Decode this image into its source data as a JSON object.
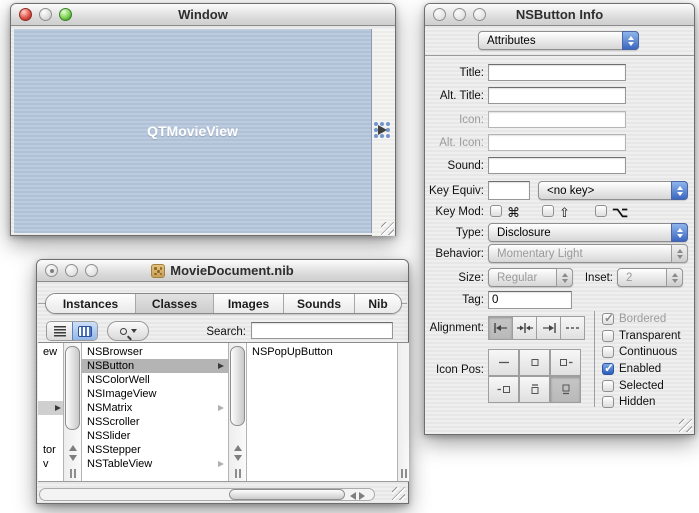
{
  "colors": {
    "accent_blue": "#3c67c0",
    "selection_gray": "#b4b4b4",
    "view_blue": "#b3c2da"
  },
  "design_window": {
    "title": "Window",
    "view_label": "QTMovieView"
  },
  "nib_window": {
    "title": "MovieDocument.nib",
    "tabs": [
      {
        "label": "Instances"
      },
      {
        "label": "Classes"
      },
      {
        "label": "Images"
      },
      {
        "label": "Sounds"
      },
      {
        "label": "Nib"
      }
    ],
    "selected_tab": "Classes",
    "toolbar": {
      "search_label": "Search:",
      "search_value": ""
    },
    "browser": {
      "col1_fragments": [
        "ew",
        "tor",
        "v"
      ],
      "col2": [
        "NSBrowser",
        "NSButton",
        "NSColorWell",
        "NSImageView",
        "NSMatrix",
        "NSScroller",
        "NSSlider",
        "NSStepper",
        "NSTableView"
      ],
      "col2_selected": "NSButton",
      "col3": [
        "NSPopUpButton"
      ]
    }
  },
  "inspector": {
    "title": "NSButton Info",
    "pane": "Attributes",
    "labels": {
      "title": "Title:",
      "alt_title": "Alt. Title:",
      "icon": "Icon:",
      "alt_icon": "Alt. Icon:",
      "sound": "Sound:",
      "key_equiv": "Key Equiv:",
      "key_mod": "Key Mod:",
      "type": "Type:",
      "behavior": "Behavior:",
      "size": "Size:",
      "inset": "Inset:",
      "tag": "Tag:",
      "alignment": "Alignment:",
      "icon_pos": "Icon Pos:"
    },
    "values": {
      "title": "",
      "alt_title": "",
      "icon": "",
      "alt_icon": "",
      "sound": "",
      "key_equiv": "",
      "key_popup": "<no key>",
      "type": "Disclosure",
      "behavior": "Momentary Light",
      "size": "Regular",
      "inset": "2",
      "tag": "0"
    },
    "key_mod_symbols": [
      "⌘",
      "⇧",
      "⌥"
    ],
    "checkboxes": [
      {
        "label": "Bordered",
        "checked": true,
        "disabled": true
      },
      {
        "label": "Transparent",
        "checked": false,
        "disabled": false
      },
      {
        "label": "Continuous",
        "checked": false,
        "disabled": false
      },
      {
        "label": "Enabled",
        "checked": true,
        "disabled": false
      },
      {
        "label": "Selected",
        "checked": false,
        "disabled": false
      },
      {
        "label": "Hidden",
        "checked": false,
        "disabled": false
      }
    ]
  }
}
